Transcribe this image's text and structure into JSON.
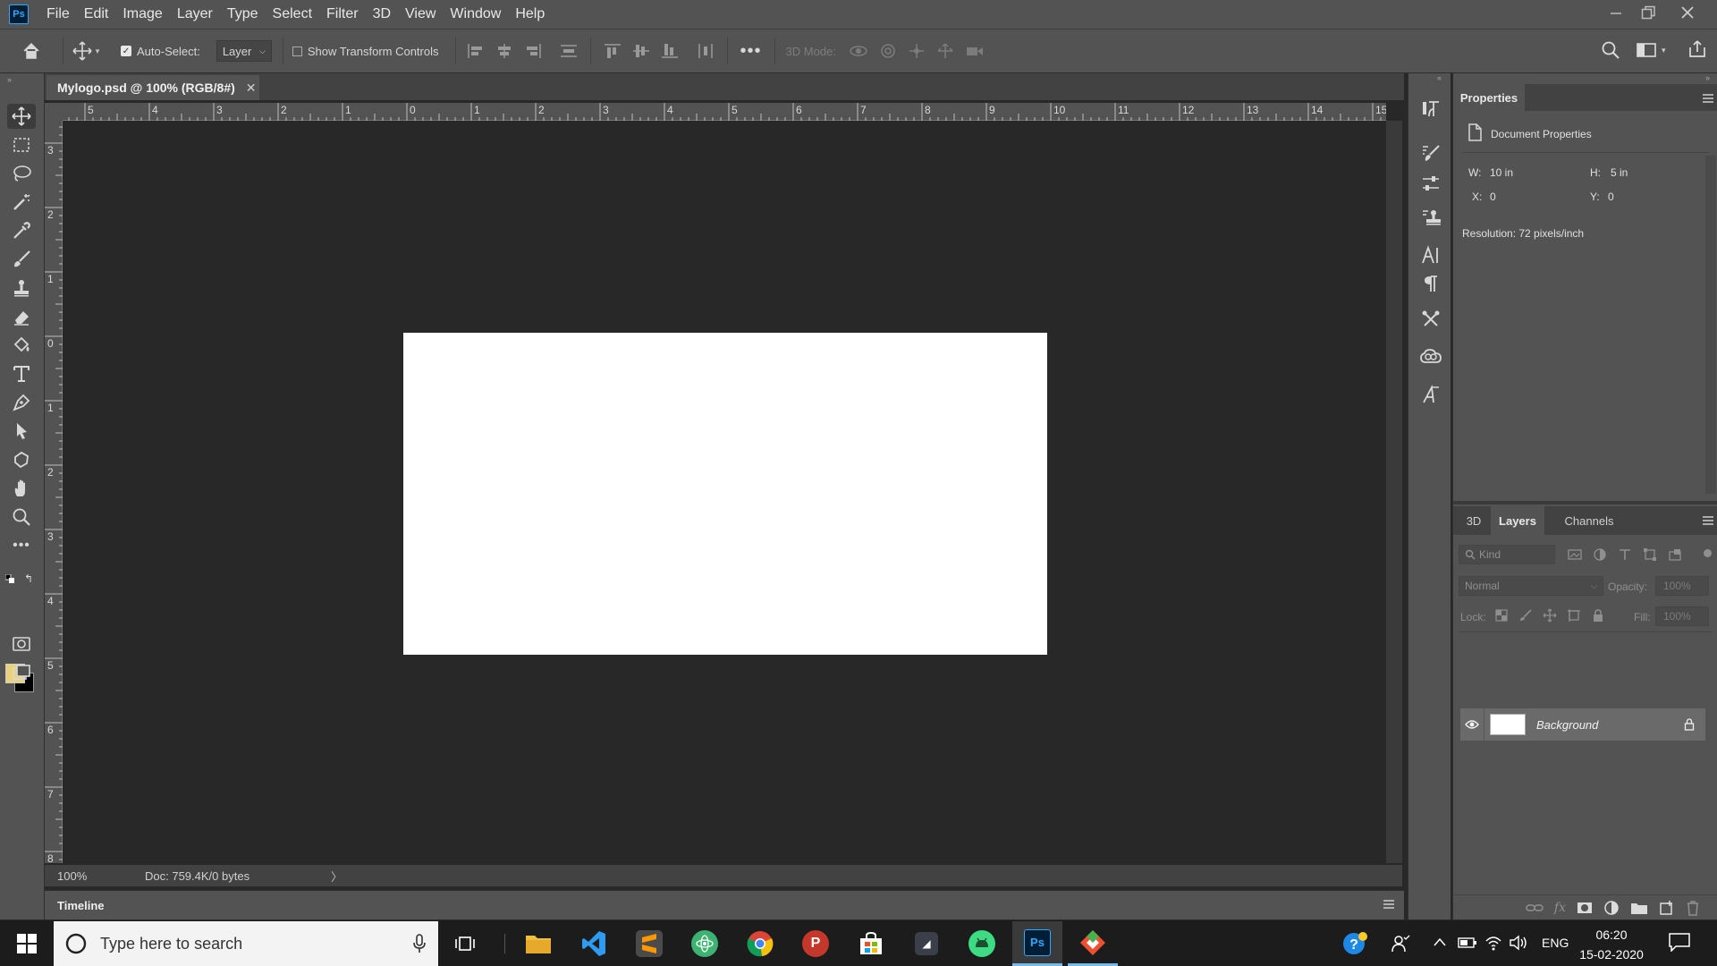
{
  "app": {
    "logo_text": "Ps"
  },
  "menu": [
    "File",
    "Edit",
    "Image",
    "Layer",
    "Type",
    "Select",
    "Filter",
    "3D",
    "View",
    "Window",
    "Help"
  ],
  "options_bar": {
    "auto_select_label": "Auto-Select:",
    "auto_select_checked": true,
    "auto_select_target": "Layer",
    "show_transform_label": "Show Transform Controls",
    "three_d_mode_label": "3D Mode:"
  },
  "document": {
    "tab_title": "Mylogo.psd @ 100% (RGB/8#)",
    "zoom": "100%",
    "doc_info": "Doc: 759.4K/0 bytes",
    "canvas_color": "#ffffff"
  },
  "rulers": {
    "horizontal_ticks": [
      "5",
      "4",
      "3",
      "2",
      "1",
      "0",
      "1",
      "2",
      "3",
      "4",
      "5",
      "6",
      "7",
      "8",
      "9",
      "10",
      "11",
      "12",
      "13",
      "14",
      "15"
    ],
    "vertical_ticks": [
      "3",
      "2",
      "1",
      "0",
      "1",
      "2",
      "3",
      "4",
      "5",
      "6",
      "7",
      "8"
    ]
  },
  "timeline": {
    "label": "Timeline"
  },
  "properties": {
    "tab": "Properties",
    "section": "Document Properties",
    "w_label": "W:",
    "w_value": "10 in",
    "h_label": "H:",
    "h_value": "5 in",
    "x_label": "X:",
    "x_value": "0",
    "y_label": "Y:",
    "y_value": "0",
    "resolution": "Resolution: 72 pixels/inch"
  },
  "layers_panel": {
    "tabs": [
      "3D",
      "Layers",
      "Channels"
    ],
    "active_tab": "Layers",
    "filter_placeholder": "Kind",
    "blend_mode": "Normal",
    "opacity_label": "Opacity:",
    "opacity_value": "100%",
    "lock_label": "Lock:",
    "fill_label": "Fill:",
    "fill_value": "100%",
    "layers": [
      {
        "name": "Background",
        "locked": true,
        "visible": true
      }
    ]
  },
  "colors": {
    "foreground": "#e8d27a",
    "background": "#000000",
    "accent": "#31a8ff"
  },
  "taskbar": {
    "search_placeholder": "Type here to search",
    "language": "ENG",
    "time": "06:20",
    "date": "15-02-2020"
  }
}
